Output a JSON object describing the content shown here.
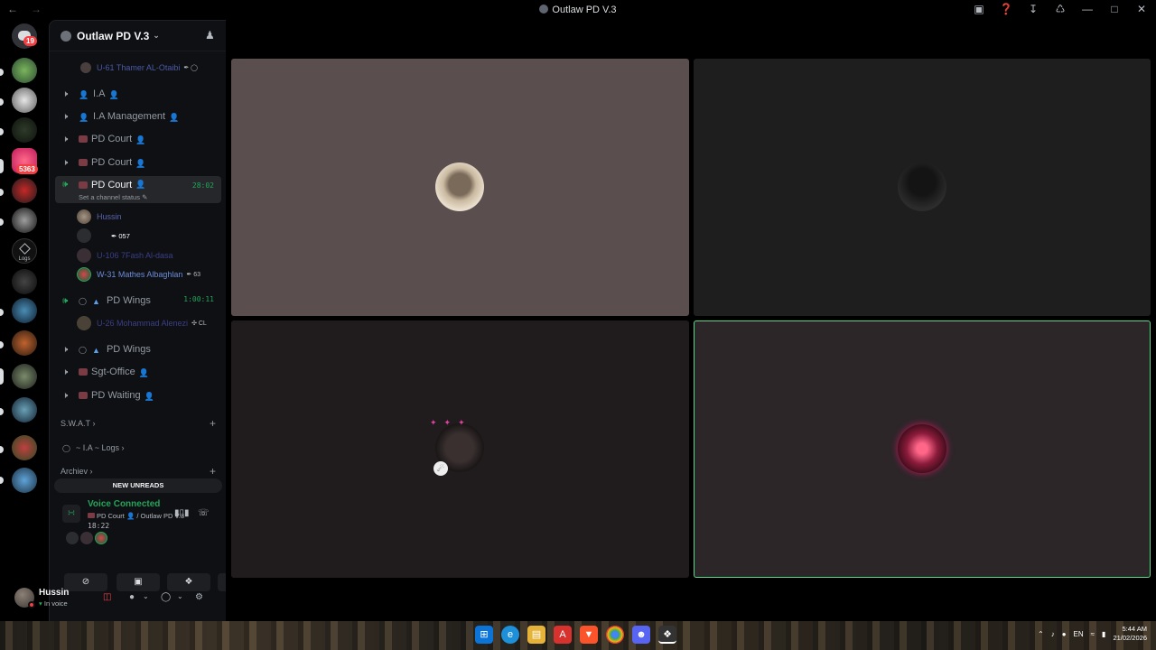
{
  "window": {
    "title": "Outlaw PD V.3",
    "back_icon": "arrow-left-icon",
    "forward_icon": "arrow-right-icon"
  },
  "toolbar_icons": [
    "inbox-icon",
    "help-icon",
    "download-icon",
    "clan-icon"
  ],
  "rail": {
    "home_badge": "19",
    "server_badge": "5363",
    "logs_label": "Logs"
  },
  "server": {
    "name": "Outlaw PD V.3"
  },
  "channels": [
    {
      "name": "I.A"
    },
    {
      "name": "I.A Management"
    },
    {
      "name": "PD Court"
    },
    {
      "name": "PD Court"
    },
    {
      "name": "PD Court",
      "timer": "28:02",
      "status": "Set a channel status"
    },
    {
      "name": "PD Wings",
      "timer": "1:00:11"
    },
    {
      "name": "PD Wings"
    },
    {
      "name": "Sgt-Office"
    },
    {
      "name": "PD Waiting"
    }
  ],
  "users": {
    "top": "U-61 Thamer AL-Otaibi",
    "court": [
      {
        "name": "Hussin",
        "tag": ""
      },
      {
        "name": "",
        "tag": "057"
      },
      {
        "name": "U-106 7Fash Al-dasa",
        "tag": ""
      },
      {
        "name": "W-31 Mathes Albaghlan",
        "tag": "63"
      }
    ],
    "wings": "U-26 Mohammad Alenezi",
    "wings_tag": "CL"
  },
  "categories": {
    "swat": "S.W.A.T",
    "ia_logs": "~ I.A ~ Logs",
    "archiev": "Archiev"
  },
  "new_unreads": "NEW UNREADS",
  "voice": {
    "title": "Voice Connected",
    "channel": "PD Court",
    "server": "/ Outlaw PD V.3",
    "time": "18:22"
  },
  "user": {
    "name": "Hussin",
    "status": "In voice"
  },
  "taskbar": {
    "time": "5:44 AM",
    "date": "21/02/2026",
    "lang": "EN"
  },
  "colors": {
    "voice_green": "#23a55a",
    "selected_border": "#5ed88b",
    "danger": "#f23f43"
  }
}
